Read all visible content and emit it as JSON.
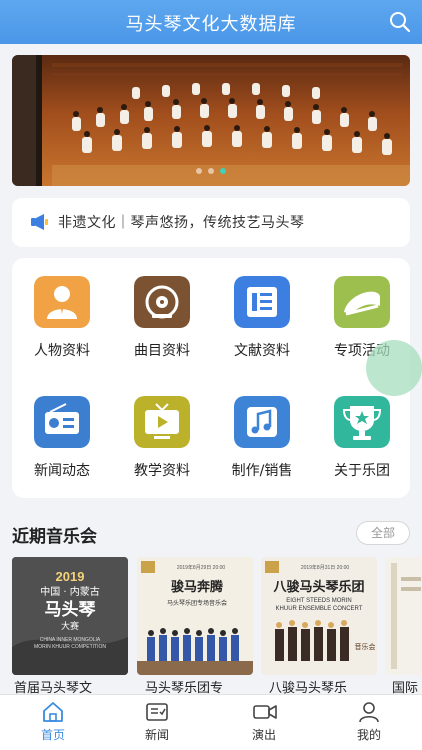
{
  "header": {
    "title": "马头琴文化大数据库"
  },
  "banner": {
    "slides": 3,
    "active_index": 2
  },
  "notice": {
    "text": "非遗文化｜琴声悠扬，传统技艺马头琴"
  },
  "categories": [
    {
      "label": "人物资料",
      "icon": "person-icon",
      "color": "#f0a245"
    },
    {
      "label": "曲目资料",
      "icon": "record-icon",
      "color": "#7b5232"
    },
    {
      "label": "文献资料",
      "icon": "document-icon",
      "color": "#3d7fe0"
    },
    {
      "label": "专项活动",
      "icon": "hat-icon",
      "color": "#9cbf4d"
    },
    {
      "label": "新闻动态",
      "icon": "radio-icon",
      "color": "#3c7ecf"
    },
    {
      "label": "教学资料",
      "icon": "tv-icon",
      "color": "#bcb12b"
    },
    {
      "label": "制作/销售",
      "icon": "music-note-icon",
      "color": "#3d83d6"
    },
    {
      "label": "关于乐团",
      "icon": "trophy-icon",
      "color": "#30b79c"
    }
  ],
  "concerts": {
    "title": "近期音乐会",
    "all_label": "全部",
    "items": [
      {
        "caption": "首届马头琴文",
        "poster_lines": [
          "2019",
          "中国 · 内蒙古",
          "马头琴",
          "大赛",
          "CHINA INNER MONGOLIA",
          "MORIN KHUUR COMPETITION"
        ]
      },
      {
        "caption": "马头琴乐团专",
        "poster_lines": [
          "2019年8月29日 20:00",
          "骏马奔腾",
          "马头琴乐团专场音乐会"
        ]
      },
      {
        "caption": "八骏马头琴乐",
        "poster_lines": [
          "2019年8月31日 20:00",
          "八骏马头琴乐团",
          "EIGHT STEEDS MORIN",
          "KHUUR ENSEMBLE CONCERT",
          "音乐会"
        ]
      },
      {
        "caption": "国际",
        "poster_lines": []
      }
    ]
  },
  "tabbar": [
    {
      "label": "首页",
      "icon": "home-icon",
      "active": true
    },
    {
      "label": "新闻",
      "icon": "news-icon",
      "active": false
    },
    {
      "label": "演出",
      "icon": "video-icon",
      "active": false
    },
    {
      "label": "我的",
      "icon": "user-icon",
      "active": false
    }
  ],
  "colors": {
    "accent": "#4b97e8",
    "active_dot": "#3fd1b6"
  }
}
